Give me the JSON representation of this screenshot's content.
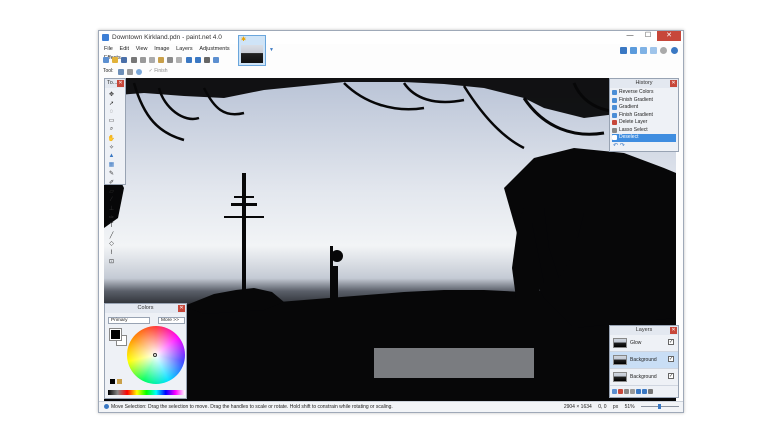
{
  "window": {
    "title": "Downtown Kirkland.pdn - paint.net 4.0",
    "min_glyph": "—",
    "max_glyph": "☐",
    "close_glyph": "✕"
  },
  "menu": [
    "File",
    "Edit",
    "View",
    "Image",
    "Layers",
    "Adjustments",
    "Effects"
  ],
  "toolbar": {
    "tool_label": "Tool:",
    "finish_label": "✓ Finish"
  },
  "colors_accent": {
    "blue": "#3a78c3",
    "close_red": "#c7473a",
    "selection": "#3f8de0"
  },
  "tools_panel": {
    "title": "To...",
    "icons": [
      "move-selection-icon",
      "move-selected-icon",
      "lasso-select-icon",
      "rectangle-select-icon",
      "zoom-icon",
      "pan-icon",
      "magic-wand-icon",
      "paint-bucket-icon",
      "gradient-icon",
      "paintbrush-icon",
      "pencil-icon",
      "eraser-icon",
      "color-picker-icon",
      "clone-stamp-icon",
      "recolor-icon",
      "text-icon",
      "line-curve-icon",
      "shapes-icon",
      "brush-icon",
      "stamp-icon"
    ]
  },
  "history": {
    "title": "History",
    "items": [
      {
        "label": "Reverse Colors",
        "selected": false
      },
      {
        "label": "Finish Gradient",
        "selected": false
      },
      {
        "label": "Gradient",
        "selected": false
      },
      {
        "label": "Finish Gradient",
        "selected": false
      },
      {
        "label": "Delete Layer",
        "selected": false
      },
      {
        "label": "Lasso Select",
        "selected": false
      },
      {
        "label": "Deselect",
        "selected": true
      }
    ]
  },
  "colors_panel": {
    "title": "Colors",
    "primary_select": "Primary",
    "more_button": "More >>"
  },
  "layers": {
    "title": "Layers",
    "items": [
      {
        "name": "Glow",
        "checked": true,
        "selected": false
      },
      {
        "name": "Background",
        "checked": true,
        "selected": true
      },
      {
        "name": "Background",
        "checked": true,
        "selected": false
      }
    ]
  },
  "status": {
    "message": "Move Selection: Drag the selection to move. Drag the handles to scale or rotate. Hold shift to constrain while rotating or scaling.",
    "size": "2904 × 1634",
    "position": "0, 0",
    "units": "px",
    "zoom": "51%"
  }
}
